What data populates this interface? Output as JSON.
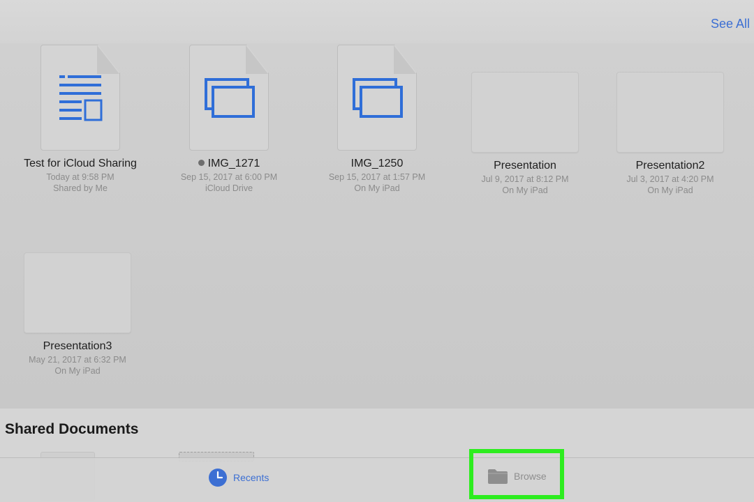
{
  "header": {
    "see_all_label": "See All"
  },
  "recents": {
    "items": [
      {
        "name": "Test for iCloud Sharing",
        "date": "Today at 9:58 PM",
        "location": "Shared by Me",
        "icon": "document-page-icon"
      },
      {
        "name": "IMG_1271",
        "date": "Sep 15, 2017 at 6:00 PM",
        "location": "iCloud Drive",
        "icon": "slides-page-icon",
        "status_dot": true
      },
      {
        "name": "IMG_1250",
        "date": "Sep 15, 2017 at 1:57 PM",
        "location": "On My iPad",
        "icon": "slides-page-icon"
      },
      {
        "name": "Presentation",
        "date": "Jul 9, 2017 at 8:12 PM",
        "location": "On My iPad",
        "icon": "blank-thumbnail"
      },
      {
        "name": "Presentation2",
        "date": "Jul  3, 2017 at 4:20 PM",
        "location": "On My iPad",
        "icon": "blank-thumbnail"
      },
      {
        "name": "Presentation3",
        "date": "May 21, 2017 at 6:32 PM",
        "location": "On My iPad",
        "icon": "blank-thumbnail"
      }
    ]
  },
  "shared": {
    "title": "Shared Documents"
  },
  "tab_bar": {
    "recents_label": "Recents",
    "browse_label": "Browse",
    "active_tab": "Recents"
  },
  "colors": {
    "accent": "#3c6fd3",
    "icon_blue": "#2f6ed8",
    "highlight": "#2ded1f"
  }
}
